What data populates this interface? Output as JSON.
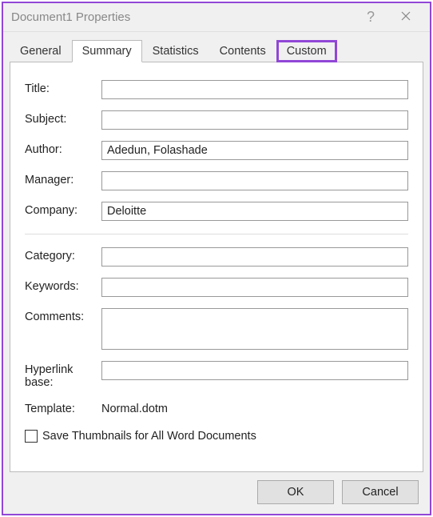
{
  "titlebar": {
    "title": "Document1 Properties"
  },
  "tabs": {
    "general": "General",
    "summary": "Summary",
    "statistics": "Statistics",
    "contents": "Contents",
    "custom": "Custom"
  },
  "fields": {
    "title_label": "Title:",
    "title_value": "",
    "subject_label": "Subject:",
    "subject_value": "",
    "author_label": "Author:",
    "author_value": "Adedun, Folashade",
    "manager_label": "Manager:",
    "manager_value": "",
    "company_label": "Company:",
    "company_value": "Deloitte",
    "category_label": "Category:",
    "category_value": "",
    "keywords_label": "Keywords:",
    "keywords_value": "",
    "comments_label": "Comments:",
    "comments_value": "",
    "hyperlink_label": "Hyperlink base:",
    "hyperlink_value": "",
    "template_label": "Template:",
    "template_value": "Normal.dotm"
  },
  "checkbox": {
    "label": "Save Thumbnails for All Word Documents"
  },
  "buttons": {
    "ok": "OK",
    "cancel": "Cancel"
  }
}
